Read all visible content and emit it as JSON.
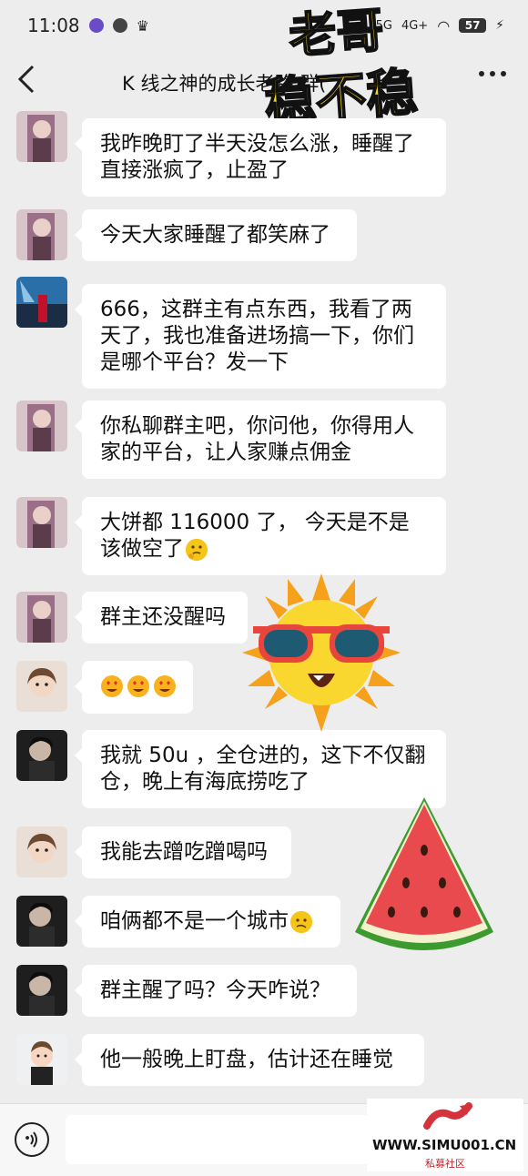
{
  "status_bar": {
    "time": "11:08",
    "network_1": "5G",
    "network_2": "4G+",
    "battery": "57"
  },
  "header": {
    "title": "K 线之神的成长老路 群(",
    "more_icon": "more-dots-icon",
    "back_icon": "chevron-left-icon"
  },
  "sticker_text": {
    "line1": "老哥",
    "line2": "稳不稳"
  },
  "messages": [
    {
      "text": "我昨晚盯了半天没怎么涨，睡醒了直接涨疯了，止盈了",
      "avatar": "avatar-girl-purple"
    },
    {
      "text": "今天大家睡醒了都笑麻了",
      "avatar": "avatar-girl-purple"
    },
    {
      "text": "666，这群主有点东西，我看了两天了，我也准备进场搞一下，你们是哪个平台？发一下",
      "avatar": "avatar-blue-scene"
    },
    {
      "text": "你私聊群主吧，你问他，你得用人家的平台，让人家赚点佣金",
      "avatar": "avatar-girl-purple"
    },
    {
      "text": "大饼都 116000 了， 今天是不是该做空了",
      "avatar": "avatar-girl-purple",
      "emoji": "thinking-face"
    },
    {
      "text": "群主还没醒吗",
      "avatar": "avatar-girl-purple"
    },
    {
      "text": "",
      "avatar": "avatar-child",
      "emoji": "heart-eyes-face"
    },
    {
      "text": "我就 50u ，全仓进的，这下不仅翻仓，晚上有海底捞吃了",
      "avatar": "avatar-man-dark"
    },
    {
      "text": "我能去蹭吃蹭喝吗",
      "avatar": "avatar-child"
    },
    {
      "text": "咱俩都不是一个城市",
      "avatar": "avatar-man-dark",
      "emoji": "confused-face"
    },
    {
      "text": "群主醒了吗？今天咋说？",
      "avatar": "avatar-man-dark"
    },
    {
      "text": "他一般晚上盯盘，估计还在睡觉",
      "avatar": "avatar-cartoon-man"
    }
  ],
  "watermark": {
    "url": "WWW.SIMU001.CN",
    "sub": "私募社区"
  },
  "colors": {
    "background": "#ededed",
    "bubble": "#ffffff",
    "sticker_yellow": "#f3d61b",
    "watermark_red": "#c8212b"
  }
}
